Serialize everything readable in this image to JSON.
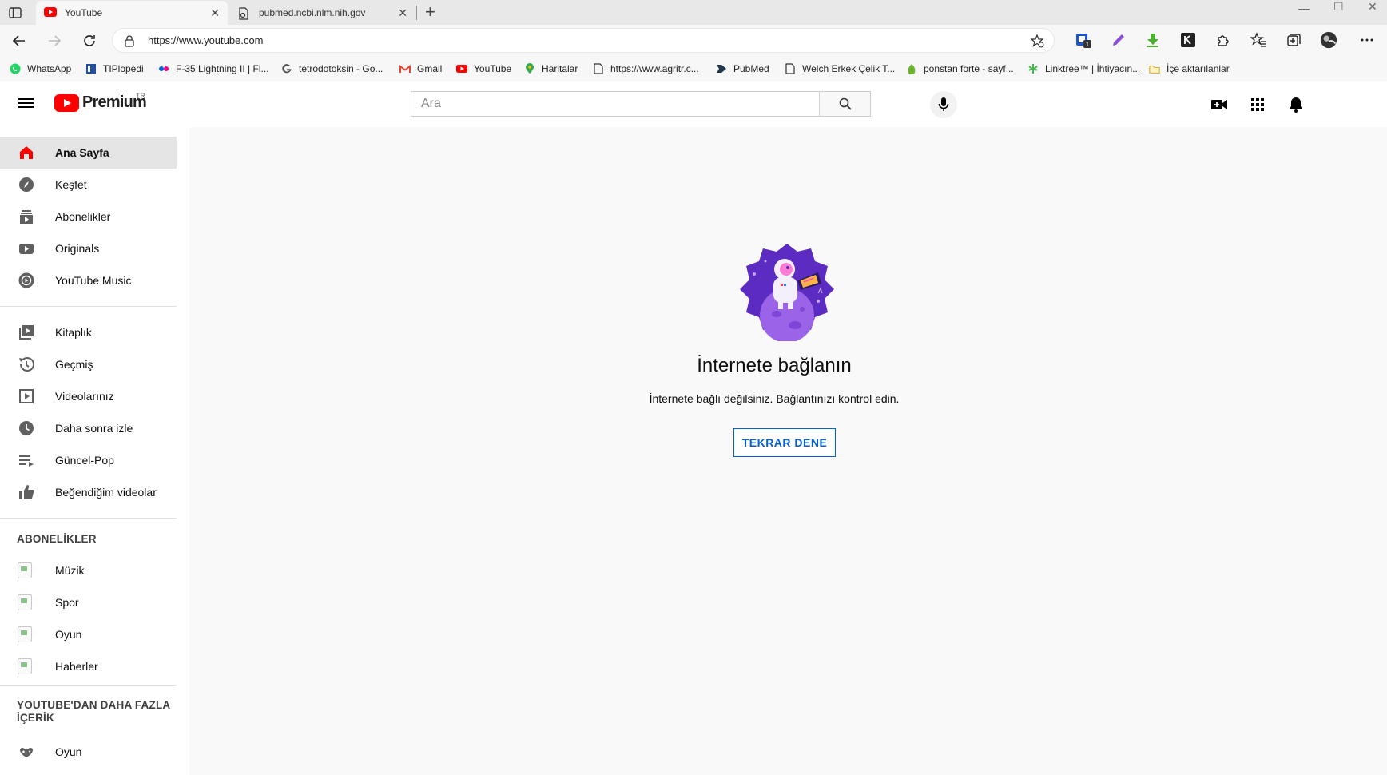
{
  "browser": {
    "tabs": [
      {
        "title": "YouTube",
        "favicon": "youtube-favicon",
        "active": true
      },
      {
        "title": "pubmed.ncbi.nlm.nih.gov",
        "favicon": "page-favicon",
        "active": false
      }
    ],
    "url": "https://www.youtube.com",
    "bookmarks": [
      {
        "label": "WhatsApp",
        "icon": "whatsapp-icon"
      },
      {
        "label": "TIPlopedi",
        "icon": "tiplopedi-icon"
      },
      {
        "label": "F-35 Lightning II | Fl...",
        "icon": "flickr-icon"
      },
      {
        "label": "tetrodotoksin - Go...",
        "icon": "google-icon"
      },
      {
        "label": "Gmail",
        "icon": "gmail-icon"
      },
      {
        "label": "YouTube",
        "icon": "youtube-icon"
      },
      {
        "label": "Haritalar",
        "icon": "maps-icon"
      },
      {
        "label": "https://www.agritr.c...",
        "icon": "page-icon"
      },
      {
        "label": "PubMed",
        "icon": "pubmed-icon"
      },
      {
        "label": "Welch Erkek Çelik T...",
        "icon": "page-icon"
      },
      {
        "label": "ponstan forte - sayf...",
        "icon": "leaf-icon"
      },
      {
        "label": "Linktree™ | İhtiyacın...",
        "icon": "linktree-icon"
      },
      {
        "label": "İçe aktarılanlar",
        "icon": "folder-icon"
      }
    ]
  },
  "masthead": {
    "logo_word": "Premium",
    "country_code": "TR",
    "search_placeholder": "Ara"
  },
  "sidebar": {
    "primary": [
      {
        "label": "Ana Sayfa",
        "icon": "home-icon",
        "active": true
      },
      {
        "label": "Keşfet",
        "icon": "compass-icon"
      },
      {
        "label": "Abonelikler",
        "icon": "subscriptions-icon"
      },
      {
        "label": "Originals",
        "icon": "originals-icon"
      },
      {
        "label": "YouTube Music",
        "icon": "music-icon"
      }
    ],
    "library": [
      {
        "label": "Kitaplık",
        "icon": "library-icon"
      },
      {
        "label": "Geçmiş",
        "icon": "history-icon"
      },
      {
        "label": "Videolarınız",
        "icon": "your-videos-icon"
      },
      {
        "label": "Daha sonra izle",
        "icon": "watch-later-icon"
      },
      {
        "label": "Güncel-Pop",
        "icon": "playlist-icon"
      },
      {
        "label": "Beğendiğim videolar",
        "icon": "thumbs-up-icon"
      }
    ],
    "subscriptions_heading": "ABONELİKLER",
    "subscriptions": [
      {
        "label": "Müzik"
      },
      {
        "label": "Spor"
      },
      {
        "label": "Oyun"
      },
      {
        "label": "Haberler"
      }
    ],
    "more_heading": "YOUTUBE'DAN DAHA FAZLA İÇERİK",
    "more": [
      {
        "label": "Oyun",
        "icon": "gaming-icon"
      }
    ]
  },
  "main": {
    "title": "İnternete bağlanın",
    "message": "İnternete bağlı değilsiniz. Bağlantınızı kontrol edin.",
    "retry_label": "TEKRAR DENE"
  },
  "colors": {
    "youtube_red": "#ff0000",
    "link_blue": "#065fd4",
    "illustration_purple": "#6f3ad8"
  }
}
